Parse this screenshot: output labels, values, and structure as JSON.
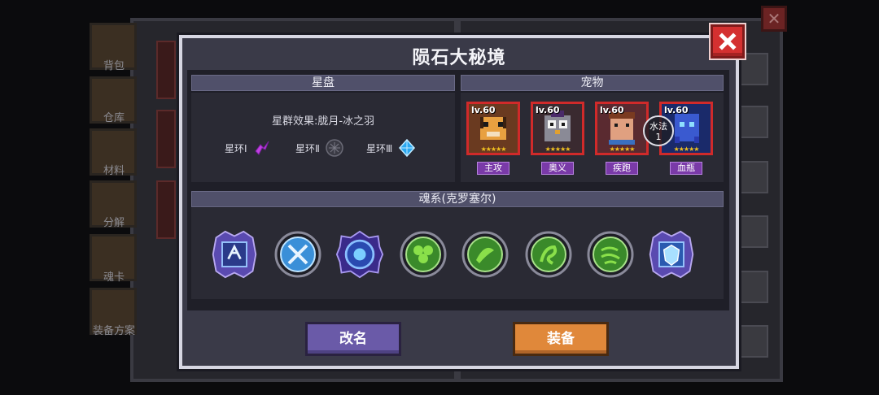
{
  "background": {
    "side_labels": [
      "背包",
      "仓库",
      "材料",
      "分解",
      "魂卡",
      "装备方案"
    ]
  },
  "dialog": {
    "title": "陨石大秘境",
    "star_disk": {
      "header": "星盘",
      "effect": "星群效果:胧月-冰之羽",
      "rings": [
        {
          "label": "星环Ⅰ",
          "icon": "purple-bird-icon"
        },
        {
          "label": "星环Ⅱ",
          "icon": "empty-ring-icon"
        },
        {
          "label": "星环Ⅲ",
          "icon": "blue-crystal-icon"
        }
      ]
    },
    "pets": {
      "header": "宠物",
      "items": [
        {
          "level": "lv.60",
          "tag": "主攻",
          "stars": "★★★★★",
          "icon": "tiger-pet-icon"
        },
        {
          "level": "lv.60",
          "tag": "奥义",
          "stars": "★★★★★",
          "icon": "owl-pet-icon"
        },
        {
          "level": "lv.60",
          "tag": "疾跑",
          "stars": "★★★★★",
          "icon": "bear-pet-icon"
        },
        {
          "level": "lv.60",
          "tag": "血瓶",
          "stars": "★★★★★",
          "icon": "ghost-pet-icon",
          "badge": "水法\n1"
        }
      ]
    },
    "soul": {
      "header": "魂系(克罗塞尔)",
      "skills": [
        {
          "icon": "ice-rune-icon",
          "color": "#7fa6e8"
        },
        {
          "icon": "crossed-swords-icon",
          "color": "#3a8fd8"
        },
        {
          "icon": "frost-orb-icon",
          "color": "#4a6fd0"
        },
        {
          "icon": "clover-icon",
          "color": "#4aa83a"
        },
        {
          "icon": "leaf-swirl-icon",
          "color": "#4aa83a"
        },
        {
          "icon": "vine-icon",
          "color": "#4aa83a"
        },
        {
          "icon": "wind-icon",
          "color": "#4aa83a"
        },
        {
          "icon": "ice-shield-icon",
          "color": "#7fa6e8"
        }
      ]
    },
    "buttons": {
      "rename": "改名",
      "equip": "装备"
    }
  }
}
